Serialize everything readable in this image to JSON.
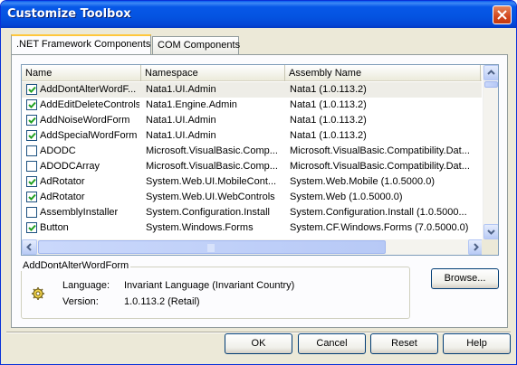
{
  "window": {
    "title": "Customize Toolbox"
  },
  "tabs": [
    {
      "label": ".NET Framework Components",
      "active": true
    },
    {
      "label": "COM Components",
      "active": false
    }
  ],
  "columns": [
    "Name",
    "Namespace",
    "Assembly Name"
  ],
  "rows": [
    {
      "checked": true,
      "name": "AddDontAlterWordF...",
      "namespace": "Nata1.UI.Admin",
      "assembly": "Nata1 (1.0.113.2)",
      "selected": true
    },
    {
      "checked": true,
      "name": "AddEditDeleteControls",
      "namespace": "Nata1.Engine.Admin",
      "assembly": "Nata1 (1.0.113.2)"
    },
    {
      "checked": true,
      "name": "AddNoiseWordForm",
      "namespace": "Nata1.UI.Admin",
      "assembly": "Nata1 (1.0.113.2)"
    },
    {
      "checked": true,
      "name": "AddSpecialWordForm",
      "namespace": "Nata1.UI.Admin",
      "assembly": "Nata1 (1.0.113.2)"
    },
    {
      "checked": false,
      "name": "ADODC",
      "namespace": "Microsoft.VisualBasic.Comp...",
      "assembly": "Microsoft.VisualBasic.Compatibility.Dat..."
    },
    {
      "checked": false,
      "name": "ADODCArray",
      "namespace": "Microsoft.VisualBasic.Comp...",
      "assembly": "Microsoft.VisualBasic.Compatibility.Dat..."
    },
    {
      "checked": true,
      "name": "AdRotator",
      "namespace": "System.Web.UI.MobileCont...",
      "assembly": "System.Web.Mobile (1.0.5000.0)"
    },
    {
      "checked": true,
      "name": "AdRotator",
      "namespace": "System.Web.UI.WebControls",
      "assembly": "System.Web (1.0.5000.0)"
    },
    {
      "checked": false,
      "name": "AssemblyInstaller",
      "namespace": "System.Configuration.Install",
      "assembly": "System.Configuration.Install (1.0.5000..."
    },
    {
      "checked": true,
      "name": "Button",
      "namespace": "System.Windows.Forms",
      "assembly": "System.CF.Windows.Forms (7.0.5000.0)"
    }
  ],
  "info": {
    "selected_name": "AddDontAlterWordForm",
    "language_label": "Language:",
    "language_value": "Invariant Language (Invariant Country)",
    "version_label": "Version:",
    "version_value": "1.0.113.2 (Retail)",
    "icon": "component-gear-icon"
  },
  "buttons": {
    "browse": "Browse...",
    "ok": "OK",
    "cancel": "Cancel",
    "reset": "Reset",
    "help": "Help"
  }
}
